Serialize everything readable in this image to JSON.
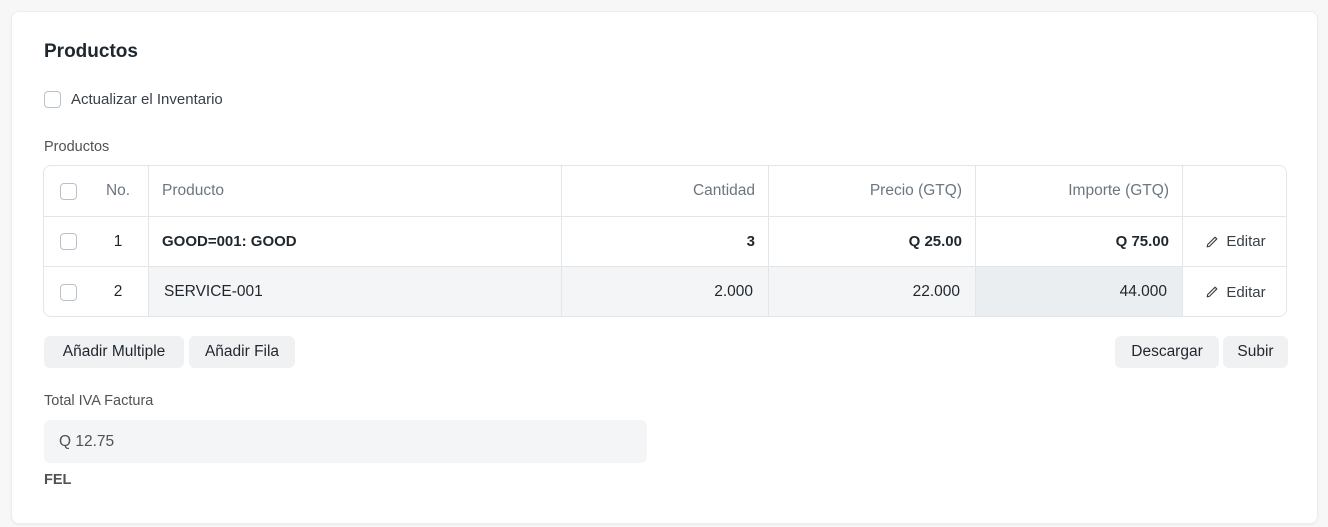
{
  "section": {
    "title": "Productos"
  },
  "update_stock": {
    "label": "Actualizar el Inventario",
    "checked": false
  },
  "items_table": {
    "label": "Productos",
    "headers": {
      "no": "No.",
      "item": "Producto",
      "qty": "Cantidad",
      "rate": "Precio (GTQ)",
      "amount": "Importe (GTQ)"
    },
    "rows": [
      {
        "no": "1",
        "item": "GOOD=001: GOOD",
        "qty": "3",
        "rate": "Q 25.00",
        "amount": "Q 75.00",
        "edit": "Editar"
      },
      {
        "no": "2",
        "item": "SERVICE-001",
        "qty": "2.000",
        "rate": "22.000",
        "amount": "44.000",
        "edit": "Editar"
      }
    ],
    "buttons": {
      "add_multiple": "Añadir Multiple",
      "add_row": "Añadir Fila",
      "download": "Descargar",
      "upload": "Subir"
    }
  },
  "total_tax": {
    "label": "Total IVA Factura",
    "value": "Q 12.75"
  },
  "fel": {
    "label": "FEL"
  },
  "icons": {
    "edit": "pencil-icon"
  },
  "colors": {
    "border": "#e2e6e9",
    "row_highlight": "#f4f5f6",
    "active_cell": "#ebeef0",
    "button_bg": "#f0f1f2"
  }
}
